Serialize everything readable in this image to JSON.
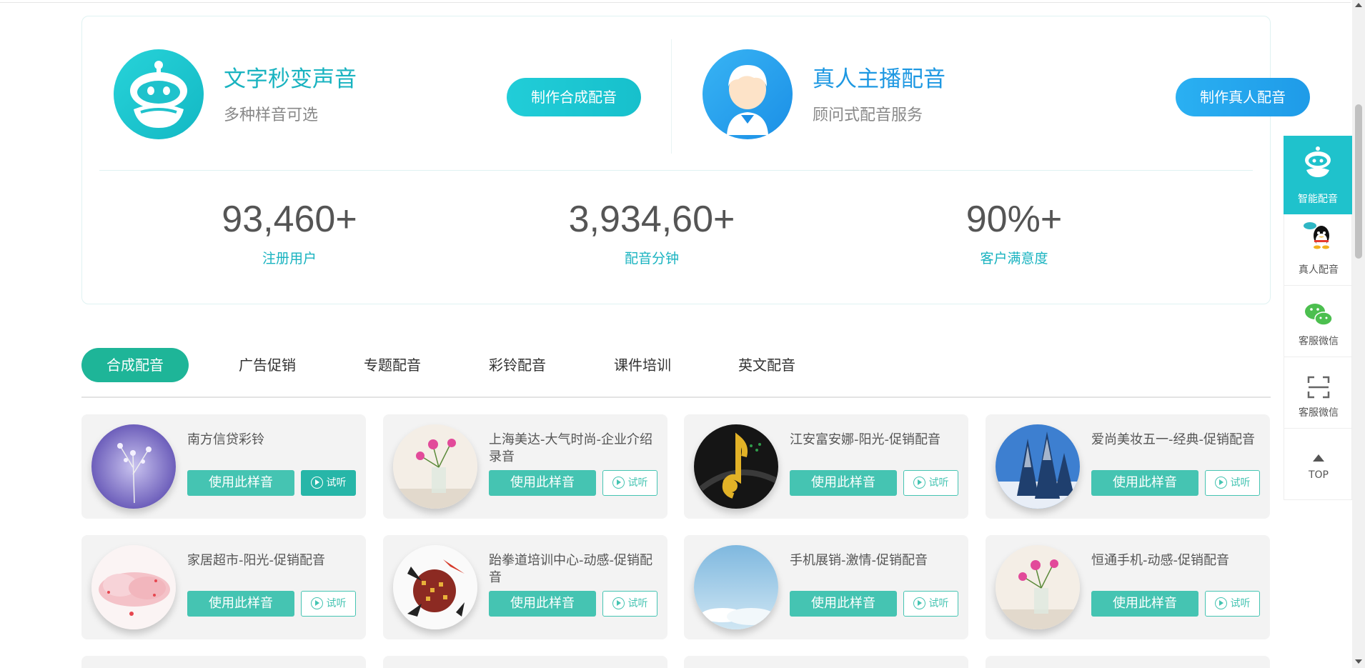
{
  "hero": {
    "left": {
      "title": "文字秒变声音",
      "subtitle": "多种样音可选",
      "button": "制作合成配音"
    },
    "right": {
      "title": "真人主播配音",
      "subtitle": "顾问式配音服务",
      "button": "制作真人配音"
    }
  },
  "stats": [
    {
      "value": "93,460+",
      "label": "注册用户"
    },
    {
      "value": "3,934,60+",
      "label": "配音分钟"
    },
    {
      "value": "90%+",
      "label": "客户满意度"
    }
  ],
  "tabs": [
    "合成配音",
    "广告促销",
    "专题配音",
    "彩铃配音",
    "课件培训",
    "英文配音"
  ],
  "active_tab": "合成配音",
  "cards": [
    {
      "name": "南方信贷彩铃",
      "use": "使用此样音",
      "try": "试听",
      "thumb": "lavender-flowers"
    },
    {
      "name": "上海美达-大气时尚-企业介绍录音",
      "use": "使用此样音",
      "try": "试听",
      "thumb": "pink-flowers-vase"
    },
    {
      "name": "江安富安娜-阳光-促销配音",
      "use": "使用此样音",
      "try": "试听",
      "thumb": "music-note"
    },
    {
      "name": "爱尚美妆五一-经典-促销配音",
      "use": "使用此样音",
      "try": "试听",
      "thumb": "snowy-trees"
    },
    {
      "name": "家居超市-阳光-促销配音",
      "use": "使用此样音",
      "try": "试听",
      "thumb": "pink-cloud"
    },
    {
      "name": "跆拳道培训中心-动感-促销配音",
      "use": "使用此样音",
      "try": "试听",
      "thumb": "disco-ball"
    },
    {
      "name": "手机展销-激情-促销配音",
      "use": "使用此样音",
      "try": "试听",
      "thumb": "blue-sky"
    },
    {
      "name": "恒通手机-动感-促销配音",
      "use": "使用此样音",
      "try": "试听",
      "thumb": "pink-flowers-vase"
    }
  ],
  "sidebar": {
    "items": [
      {
        "label": "智能配音",
        "icon": "robot-icon"
      },
      {
        "label": "真人配音",
        "icon": "qq-icon"
      },
      {
        "label": "客服微信",
        "icon": "wechat-icon"
      },
      {
        "label": "客服微信",
        "icon": "scan-icon"
      },
      {
        "label": "TOP",
        "icon": "arrow-up-icon"
      }
    ]
  },
  "colors": {
    "accent": "#1eb598",
    "cyan": "#19b3c0",
    "blue": "#1e98e2",
    "button": "#45c4b2"
  }
}
